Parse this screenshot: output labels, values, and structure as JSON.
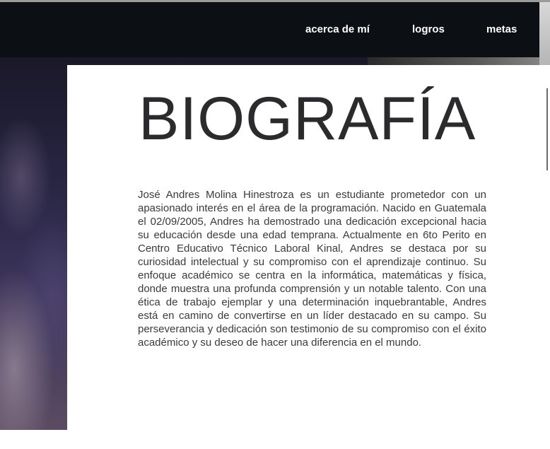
{
  "nav": {
    "items": [
      {
        "label": "acerca de mí"
      },
      {
        "label": "logros"
      },
      {
        "label": "metas"
      }
    ]
  },
  "main": {
    "title": "BIOGRAFÍA",
    "biography": "José Andres Molina Hinestroza es un estudiante prometedor con un apasionado interés en el área de la programación. Nacido en Guatemala el 02/09/2005, Andres ha demostrado una dedicación excepcional hacia su educación desde una edad temprana. Actualmente en 6to Perito en Centro Educativo Técnico Laboral Kinal, Andres se destaca por su curiosidad intelectual y su compromiso con el aprendizaje continuo. Su enfoque académico se centra en la informática, matemáticas y física, donde muestra una profunda comprensión y un notable talento. Con una ética de trabajo ejemplar y una determinación inquebrantable, Andres está en camino de convertirse en un líder destacado en su campo. Su perseverancia y dedicación son testimonio de su compromiso con el éxito académico y su deseo de hacer una diferencia en el mundo."
  },
  "colors": {
    "navbar_bg": "#0c0f14",
    "nav_text": "#ffffff",
    "title_text": "#2b2b2e",
    "body_text": "#3a3a3a"
  }
}
